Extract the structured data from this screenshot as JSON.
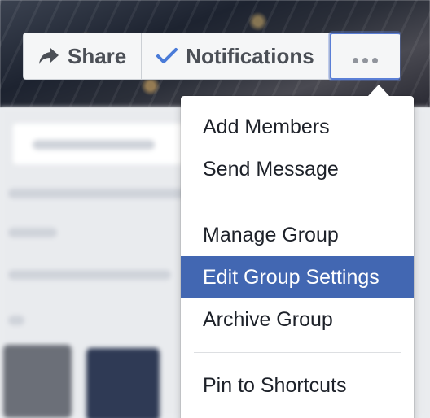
{
  "toolbar": {
    "share_label": "Share",
    "notifications_label": "Notifications",
    "more_icon": "more-dots-icon"
  },
  "menu": {
    "group1": [
      "Add Members",
      "Send Message"
    ],
    "group2": [
      "Manage Group",
      "Edit Group Settings",
      "Archive Group"
    ],
    "group3": [
      "Pin to Shortcuts"
    ],
    "highlighted": "Edit Group Settings"
  },
  "colors": {
    "accent": "#4267b2",
    "check": "#4a7bd8",
    "button_text": "#4b4f56",
    "menu_text": "#1d2129"
  }
}
